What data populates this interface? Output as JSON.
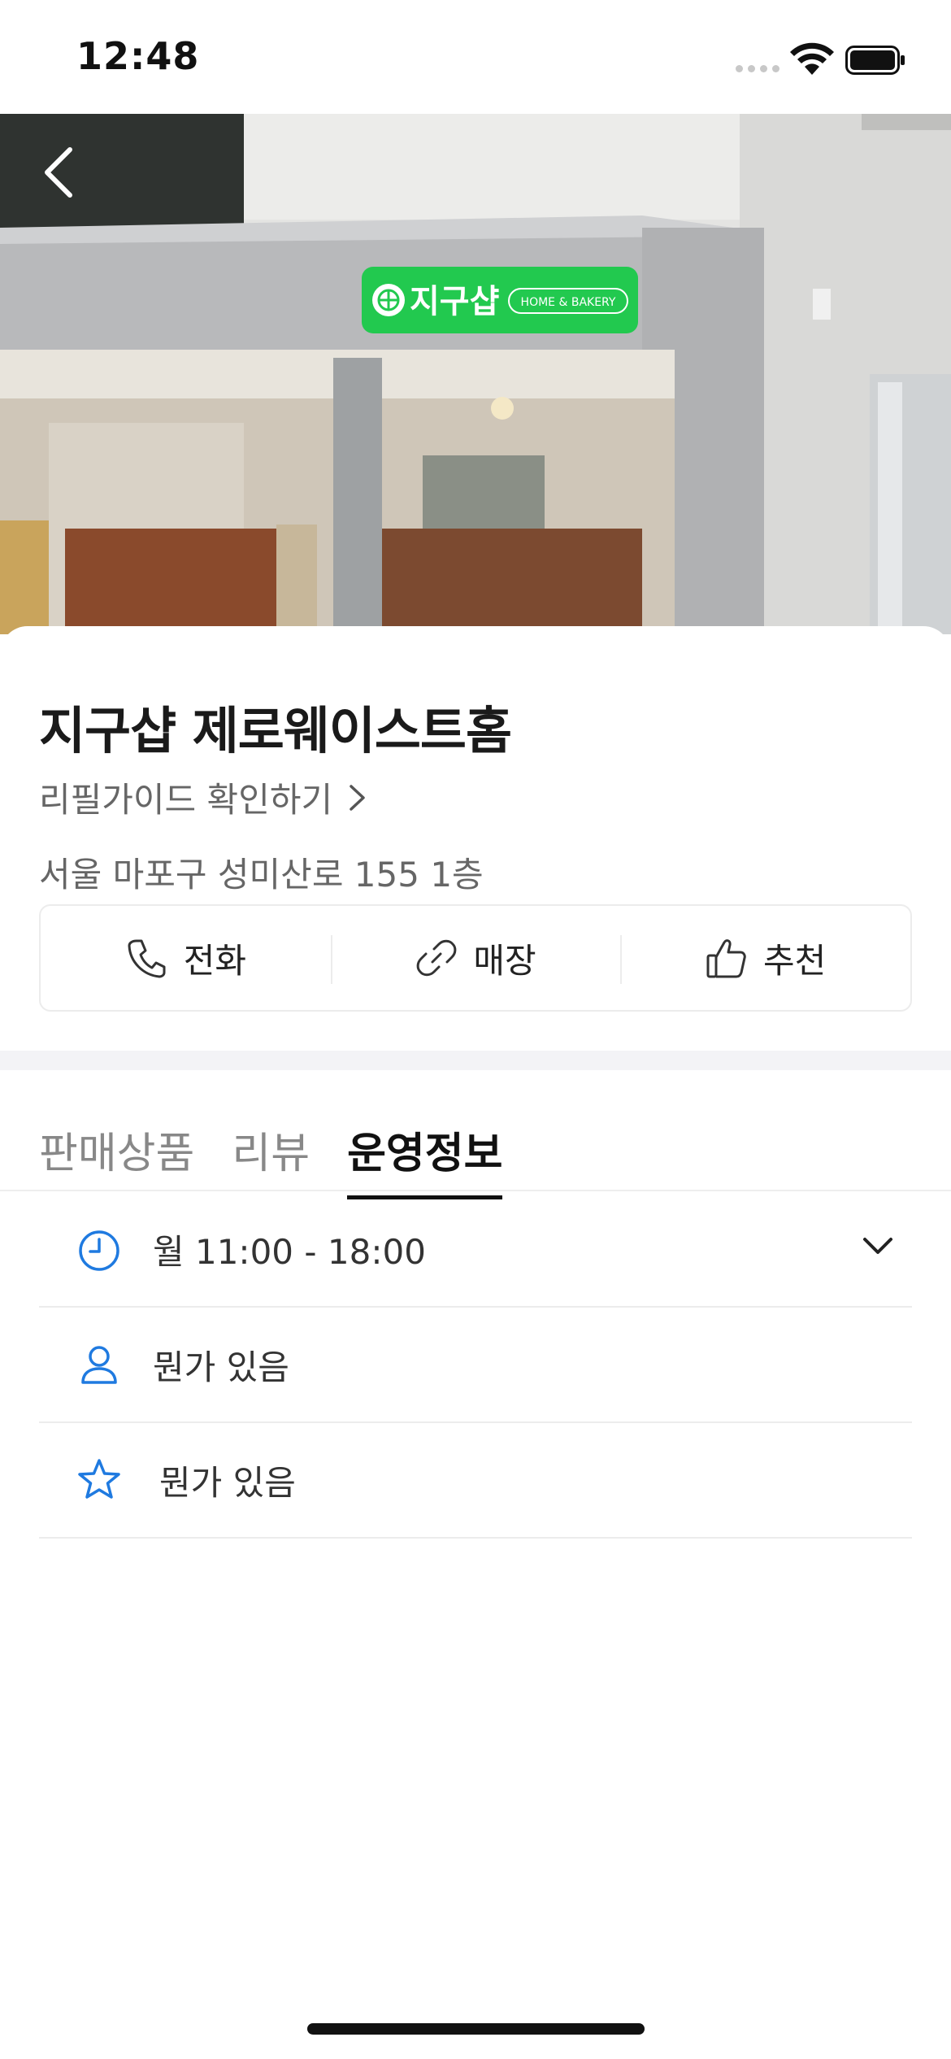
{
  "status_bar": {
    "time": "12:48"
  },
  "store": {
    "name": "지구샵 제로웨이스트홈",
    "refill_link": "리필가이드 확인하기",
    "address": "서울 마포구 성미산로 155 1층"
  },
  "sign": {
    "brand": "지구샵",
    "sub": "HOME & BAKERY"
  },
  "actions": [
    {
      "label": "전화",
      "icon": "phone-icon"
    },
    {
      "label": "매장",
      "icon": "link-icon"
    },
    {
      "label": "추천",
      "icon": "thumbs-up-icon"
    }
  ],
  "tabs": [
    {
      "label": "판매상품",
      "active": false
    },
    {
      "label": "리뷰",
      "active": false
    },
    {
      "label": "운영정보",
      "active": true
    }
  ],
  "info": [
    {
      "icon": "clock-icon",
      "text": "월 11:00 - 18:00",
      "expandable": true
    },
    {
      "icon": "person-icon",
      "text": "뭔가 있음"
    },
    {
      "icon": "star-icon",
      "text": "뭔가 있음"
    }
  ],
  "colors": {
    "accent": "#1f7ae0",
    "sign_green": "#22c94f"
  }
}
